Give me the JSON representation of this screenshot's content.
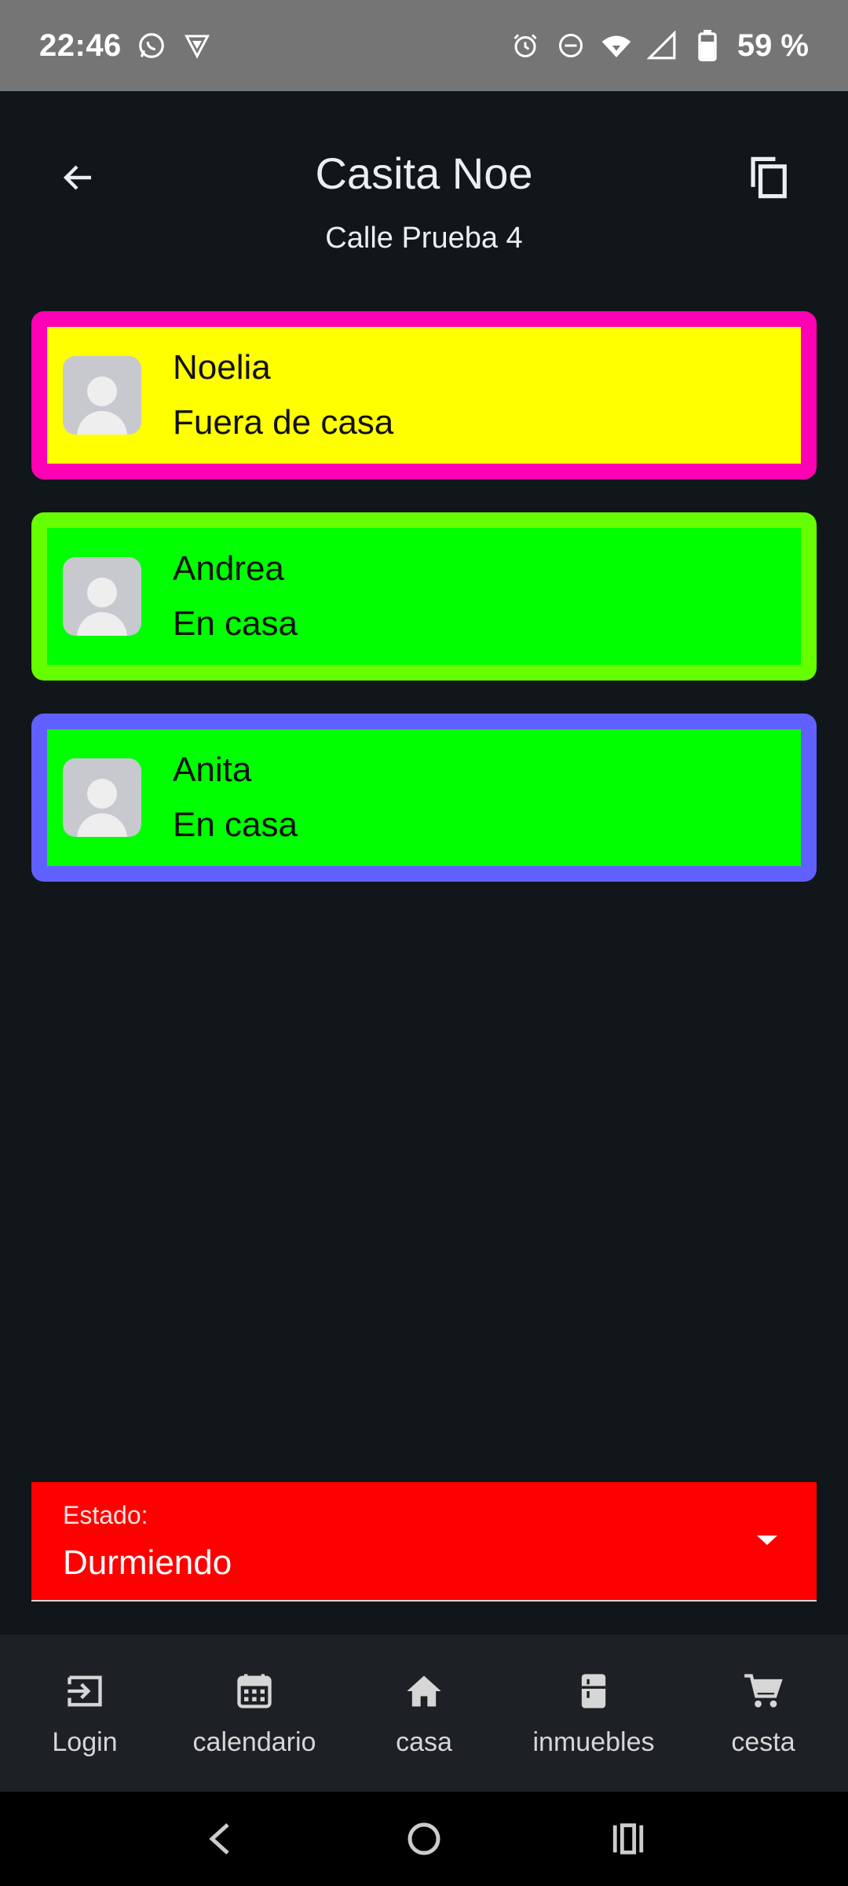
{
  "status_bar": {
    "time": "22:46",
    "battery": "59 %",
    "icons": [
      "whatsapp-icon",
      "vpn-icon",
      "alarm-icon",
      "dnd-icon",
      "wifi-icon",
      "signal-icon",
      "battery-icon"
    ]
  },
  "header": {
    "title": "Casita Noe",
    "subtitle": "Calle Prueba 4",
    "back_icon": "arrow-left-icon",
    "copy_icon": "copy-icon"
  },
  "members": [
    {
      "name": "Noelia",
      "status": "Fuera de casa",
      "border_color": "#ff00b4",
      "fill_color": "#ffff00"
    },
    {
      "name": "Andrea",
      "status": "En casa",
      "border_color": "#66ff00",
      "fill_color": "#00ff00"
    },
    {
      "name": "Anita",
      "status": "En casa",
      "border_color": "#6060ff",
      "fill_color": "#00ff00"
    }
  ],
  "estado": {
    "label": "Estado:",
    "value": "Durmiendo",
    "color": "#ff0000"
  },
  "bottom_nav": [
    {
      "label": "Login",
      "icon": "login-icon"
    },
    {
      "label": "calendario",
      "icon": "calendar-icon"
    },
    {
      "label": "casa",
      "icon": "home-icon"
    },
    {
      "label": "inmuebles",
      "icon": "fridge-icon"
    },
    {
      "label": "cesta",
      "icon": "cart-icon"
    }
  ]
}
